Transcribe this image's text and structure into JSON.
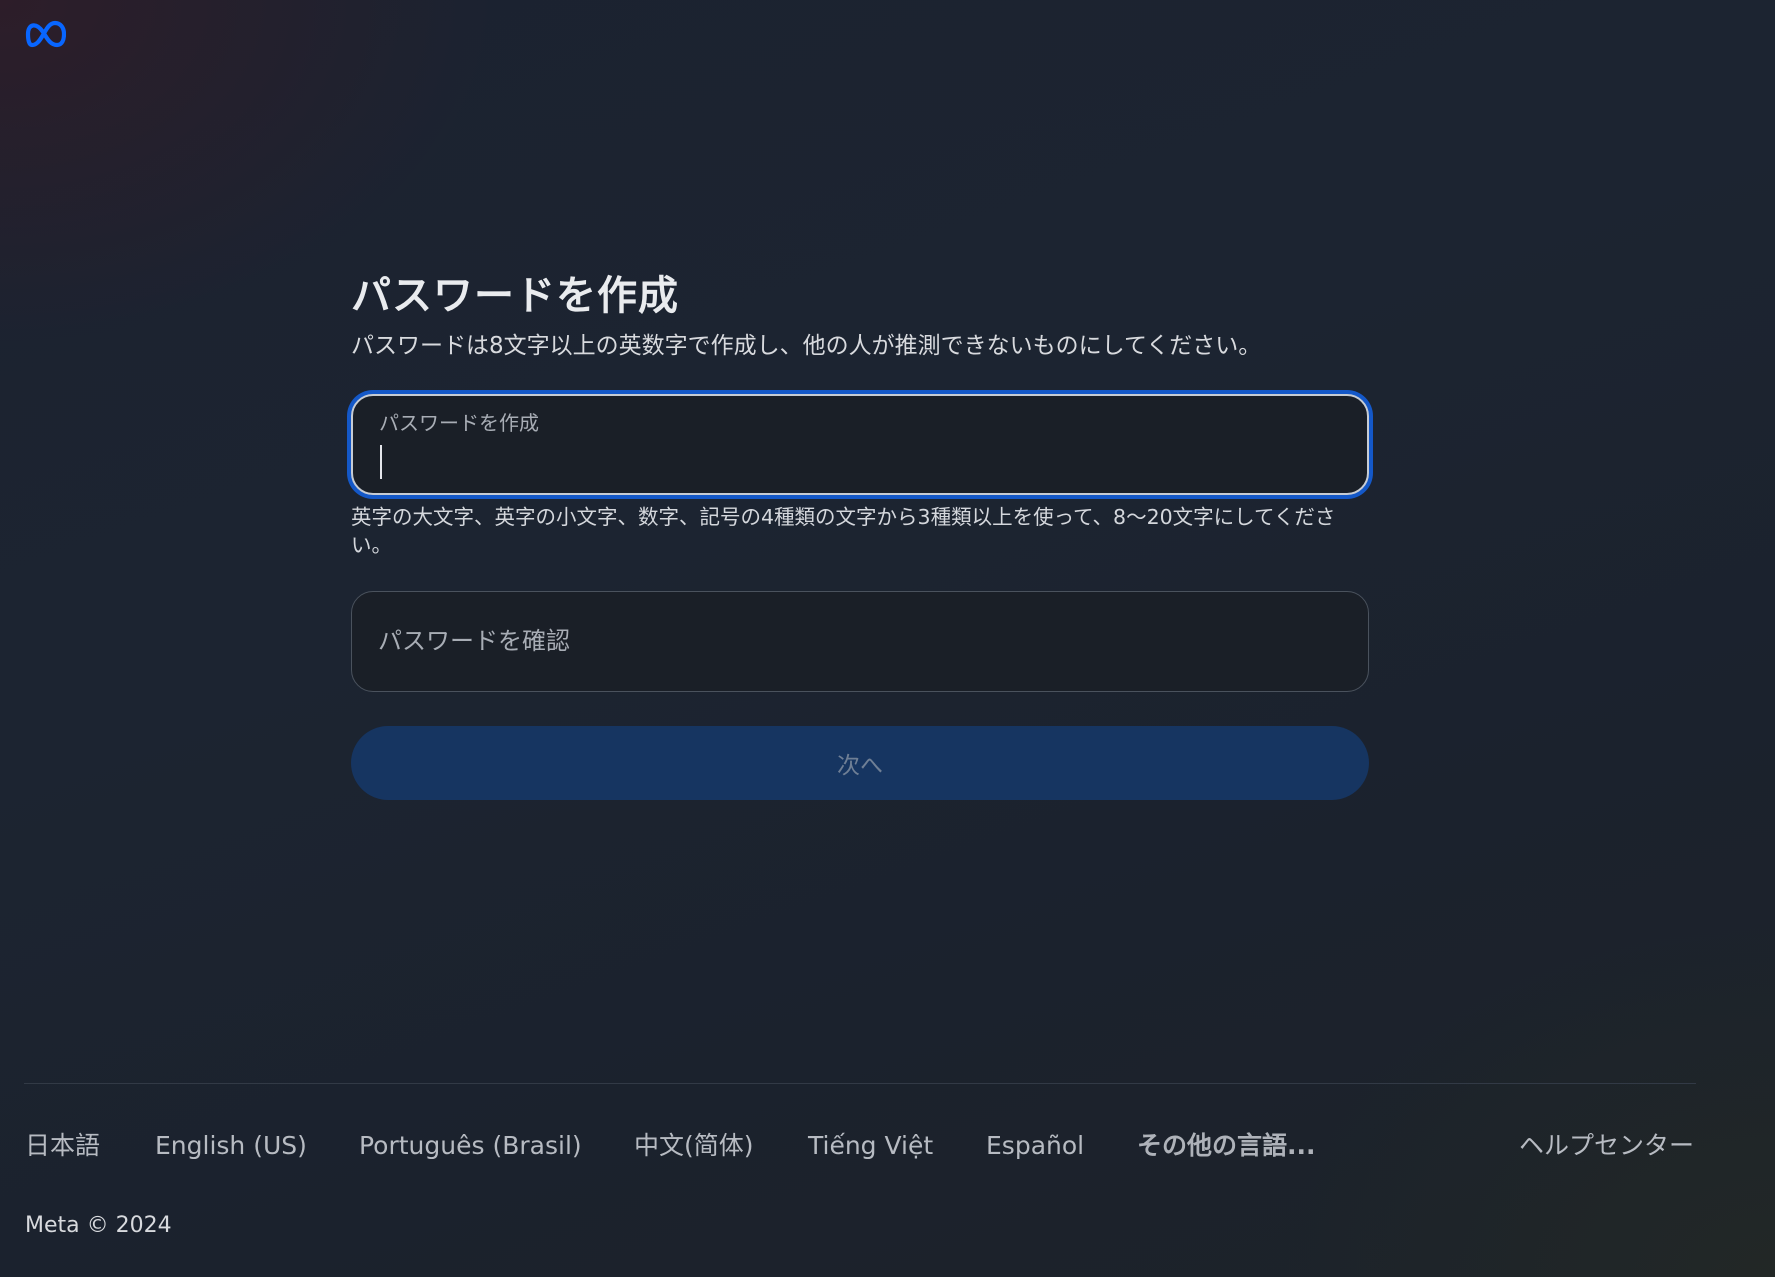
{
  "header": {
    "logo_icon": "meta-infinity-logo-icon",
    "logo_color": "#0866ff"
  },
  "form": {
    "title": "パスワードを作成",
    "subtitle": "パスワードは8文字以上の英数字で作成し、他の人が推測できないものにしてください。",
    "password_field": {
      "label": "パスワードを作成",
      "value": ""
    },
    "password_hint": "英字の大文字、英字の小文字、数字、記号の4種類の文字から3種類以上を使って、8〜20文字にしてください。",
    "confirm_field": {
      "placeholder": "パスワードを確認",
      "value": ""
    },
    "next_button": "次へ"
  },
  "footer": {
    "languages": [
      "日本語",
      "English (US)",
      "Português (Brasil)",
      "中文(简体)",
      "Tiếng Việt",
      "Español"
    ],
    "more_languages": "その他の言語...",
    "help_center": "ヘルプセンター",
    "copyright": "Meta © 2024"
  },
  "colors": {
    "focus_ring": "#1458c8",
    "button_bg_disabled": "#163561",
    "page_bg": "#1c2431"
  }
}
